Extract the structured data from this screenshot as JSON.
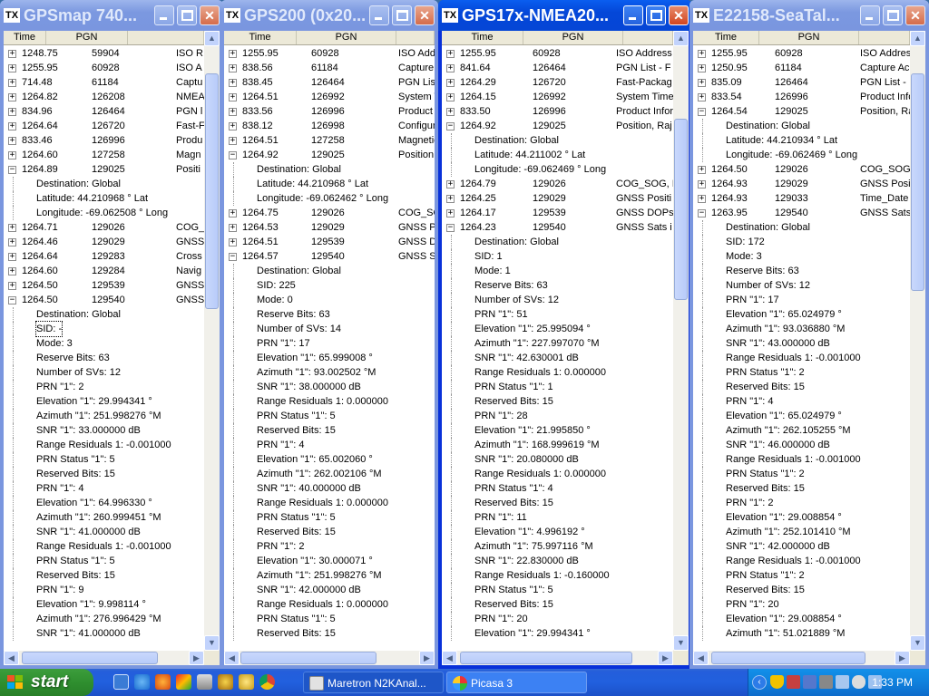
{
  "windows": [
    {
      "title": "GPSmap 740...",
      "active": false,
      "columns": {
        "time": "Time",
        "pgn": "PGN"
      },
      "rows": [
        {
          "t": "n",
          "exp": "+",
          "time": "1248.75",
          "pgn": "59904",
          "desc": "ISO R"
        },
        {
          "t": "n",
          "exp": "+",
          "time": "1255.95",
          "pgn": "60928",
          "desc": "ISO A"
        },
        {
          "t": "n",
          "exp": "+",
          "time": "714.48",
          "pgn": "61184",
          "desc": "Captu"
        },
        {
          "t": "n",
          "exp": "+",
          "time": "1264.82",
          "pgn": "126208",
          "desc": "NMEA"
        },
        {
          "t": "n",
          "exp": "+",
          "time": "834.96",
          "pgn": "126464",
          "desc": "PGN l"
        },
        {
          "t": "n",
          "exp": "+",
          "time": "1264.64",
          "pgn": "126720",
          "desc": "Fast-F"
        },
        {
          "t": "n",
          "exp": "+",
          "time": "833.46",
          "pgn": "126996",
          "desc": "Produ"
        },
        {
          "t": "n",
          "exp": "+",
          "time": "1264.60",
          "pgn": "127258",
          "desc": "Magn"
        },
        {
          "t": "n",
          "exp": "−",
          "time": "1264.89",
          "pgn": "129025",
          "desc": "Positi"
        },
        {
          "t": "f",
          "text": "Destination: Global"
        },
        {
          "t": "f",
          "text": "Latitude: 44.210968 ° Lat"
        },
        {
          "t": "f",
          "text": "Longitude: -69.062508 ° Long"
        },
        {
          "t": "n",
          "exp": "+",
          "time": "1264.71",
          "pgn": "129026",
          "desc": "COG_"
        },
        {
          "t": "n",
          "exp": "+",
          "time": "1264.46",
          "pgn": "129029",
          "desc": "GNSS"
        },
        {
          "t": "n",
          "exp": "+",
          "time": "1264.64",
          "pgn": "129283",
          "desc": "Cross"
        },
        {
          "t": "n",
          "exp": "+",
          "time": "1264.60",
          "pgn": "129284",
          "desc": "Navig"
        },
        {
          "t": "n",
          "exp": "+",
          "time": "1264.50",
          "pgn": "129539",
          "desc": "GNSS"
        },
        {
          "t": "n",
          "exp": "−",
          "time": "1264.50",
          "pgn": "129540",
          "desc": "GNSS"
        },
        {
          "t": "f",
          "text": "Destination: Global"
        },
        {
          "t": "f",
          "text": "SID: -",
          "sel": true
        },
        {
          "t": "f",
          "text": "Mode: 3"
        },
        {
          "t": "f",
          "text": "Reserve Bits: 63"
        },
        {
          "t": "f",
          "text": "Number of SVs: 12"
        },
        {
          "t": "f",
          "text": "PRN \"1\": 2"
        },
        {
          "t": "f",
          "text": "Elevation \"1\": 29.994341 °"
        },
        {
          "t": "f",
          "text": "Azimuth \"1\": 251.998276 °M"
        },
        {
          "t": "f",
          "text": "SNR \"1\": 33.000000 dB"
        },
        {
          "t": "f",
          "text": "Range Residuals 1: -0.001000"
        },
        {
          "t": "f",
          "text": "PRN Status \"1\": 5"
        },
        {
          "t": "f",
          "text": "Reserved Bits: 15"
        },
        {
          "t": "f",
          "text": "PRN \"1\": 4"
        },
        {
          "t": "f",
          "text": "Elevation \"1\": 64.996330 °"
        },
        {
          "t": "f",
          "text": "Azimuth \"1\": 260.999451 °M"
        },
        {
          "t": "f",
          "text": "SNR \"1\": 41.000000 dB"
        },
        {
          "t": "f",
          "text": "Range Residuals 1: -0.001000"
        },
        {
          "t": "f",
          "text": "PRN Status \"1\": 5"
        },
        {
          "t": "f",
          "text": "Reserved Bits: 15"
        },
        {
          "t": "f",
          "text": "PRN \"1\": 9"
        },
        {
          "t": "f",
          "text": "Elevation \"1\": 9.998114 °"
        },
        {
          "t": "f",
          "text": "Azimuth \"1\": 276.996429 °M"
        },
        {
          "t": "f",
          "text": "SNR \"1\": 41.000000 dB"
        }
      ]
    },
    {
      "title": "GPS200 (0x20...",
      "active": false,
      "columns": {
        "time": "Time",
        "pgn": "PGN"
      },
      "rows": [
        {
          "t": "n",
          "exp": "+",
          "time": "1255.95",
          "pgn": "60928",
          "desc": "ISO Addr"
        },
        {
          "t": "n",
          "exp": "+",
          "time": "838.56",
          "pgn": "61184",
          "desc": "Capture A"
        },
        {
          "t": "n",
          "exp": "+",
          "time": "838.45",
          "pgn": "126464",
          "desc": "PGN List"
        },
        {
          "t": "n",
          "exp": "+",
          "time": "1264.51",
          "pgn": "126992",
          "desc": "System T"
        },
        {
          "t": "n",
          "exp": "+",
          "time": "833.56",
          "pgn": "126996",
          "desc": "Product I"
        },
        {
          "t": "n",
          "exp": "+",
          "time": "838.12",
          "pgn": "126998",
          "desc": "Configura"
        },
        {
          "t": "n",
          "exp": "+",
          "time": "1264.51",
          "pgn": "127258",
          "desc": "Magnetic"
        },
        {
          "t": "n",
          "exp": "−",
          "time": "1264.92",
          "pgn": "129025",
          "desc": "Position,"
        },
        {
          "t": "f",
          "text": "Destination: Global"
        },
        {
          "t": "f",
          "text": "Latitude: 44.210968 ° Lat"
        },
        {
          "t": "f",
          "text": "Longitude: -69.062462 ° Long"
        },
        {
          "t": "n",
          "exp": "+",
          "time": "1264.75",
          "pgn": "129026",
          "desc": "COG_SO"
        },
        {
          "t": "n",
          "exp": "+",
          "time": "1264.53",
          "pgn": "129029",
          "desc": "GNSS Po"
        },
        {
          "t": "n",
          "exp": "+",
          "time": "1264.51",
          "pgn": "129539",
          "desc": "GNSS DO"
        },
        {
          "t": "n",
          "exp": "−",
          "time": "1264.57",
          "pgn": "129540",
          "desc": "GNSS Sa"
        },
        {
          "t": "f",
          "text": "Destination: Global"
        },
        {
          "t": "f",
          "text": "SID: 225"
        },
        {
          "t": "f",
          "text": "Mode: 0"
        },
        {
          "t": "f",
          "text": "Reserve Bits: 63"
        },
        {
          "t": "f",
          "text": "Number of SVs: 14"
        },
        {
          "t": "f",
          "text": "PRN \"1\": 17"
        },
        {
          "t": "f",
          "text": "Elevation \"1\": 65.999008 °"
        },
        {
          "t": "f",
          "text": "Azimuth \"1\": 93.002502 °M"
        },
        {
          "t": "f",
          "text": "SNR \"1\": 38.000000 dB"
        },
        {
          "t": "f",
          "text": "Range Residuals 1: 0.000000"
        },
        {
          "t": "f",
          "text": "PRN Status \"1\": 5"
        },
        {
          "t": "f",
          "text": "Reserved Bits: 15"
        },
        {
          "t": "f",
          "text": "PRN \"1\": 4"
        },
        {
          "t": "f",
          "text": "Elevation \"1\": 65.002060 °"
        },
        {
          "t": "f",
          "text": "Azimuth \"1\": 262.002106 °M"
        },
        {
          "t": "f",
          "text": "SNR \"1\": 40.000000 dB"
        },
        {
          "t": "f",
          "text": "Range Residuals 1: 0.000000"
        },
        {
          "t": "f",
          "text": "PRN Status \"1\": 5"
        },
        {
          "t": "f",
          "text": "Reserved Bits: 15"
        },
        {
          "t": "f",
          "text": "PRN \"1\": 2"
        },
        {
          "t": "f",
          "text": "Elevation \"1\": 30.000071 °"
        },
        {
          "t": "f",
          "text": "Azimuth \"1\": 251.998276 °M"
        },
        {
          "t": "f",
          "text": "SNR \"1\": 42.000000 dB"
        },
        {
          "t": "f",
          "text": "Range Residuals 1: 0.000000"
        },
        {
          "t": "f",
          "text": "PRN Status \"1\": 5"
        },
        {
          "t": "f",
          "text": "Reserved Bits: 15"
        }
      ]
    },
    {
      "title": "GPS17x-NMEA20...",
      "active": true,
      "columns": {
        "time": "Time",
        "pgn": "PGN"
      },
      "rows": [
        {
          "t": "n",
          "exp": "+",
          "time": "1255.95",
          "pgn": "60928",
          "desc": "ISO Address"
        },
        {
          "t": "n",
          "exp": "+",
          "time": "841.64",
          "pgn": "126464",
          "desc": "PGN List - F"
        },
        {
          "t": "n",
          "exp": "+",
          "time": "1264.29",
          "pgn": "126720",
          "desc": "Fast-Packag"
        },
        {
          "t": "n",
          "exp": "+",
          "time": "1264.15",
          "pgn": "126992",
          "desc": "System Time"
        },
        {
          "t": "n",
          "exp": "+",
          "time": "833.50",
          "pgn": "126996",
          "desc": "Product Infor"
        },
        {
          "t": "n",
          "exp": "−",
          "time": "1264.92",
          "pgn": "129025",
          "desc": "Position, Raj"
        },
        {
          "t": "f",
          "text": "Destination: Global"
        },
        {
          "t": "f",
          "text": "Latitude: 44.211002 ° Lat"
        },
        {
          "t": "f",
          "text": "Longitude: -69.062469 ° Long"
        },
        {
          "t": "n",
          "exp": "+",
          "time": "1264.79",
          "pgn": "129026",
          "desc": "COG_SOG, I"
        },
        {
          "t": "n",
          "exp": "+",
          "time": "1264.25",
          "pgn": "129029",
          "desc": "GNSS Positi"
        },
        {
          "t": "n",
          "exp": "+",
          "time": "1264.17",
          "pgn": "129539",
          "desc": "GNSS DOPs"
        },
        {
          "t": "n",
          "exp": "−",
          "time": "1264.23",
          "pgn": "129540",
          "desc": "GNSS Sats i"
        },
        {
          "t": "f",
          "text": "Destination: Global"
        },
        {
          "t": "f",
          "text": "SID: 1"
        },
        {
          "t": "f",
          "text": "Mode: 1"
        },
        {
          "t": "f",
          "text": "Reserve Bits: 63"
        },
        {
          "t": "f",
          "text": "Number of SVs: 12"
        },
        {
          "t": "f",
          "text": "PRN \"1\": 51"
        },
        {
          "t": "f",
          "text": "Elevation \"1\": 25.995094 °"
        },
        {
          "t": "f",
          "text": "Azimuth \"1\": 227.997070 °M"
        },
        {
          "t": "f",
          "text": "SNR \"1\": 42.630001 dB"
        },
        {
          "t": "f",
          "text": "Range Residuals 1: 0.000000"
        },
        {
          "t": "f",
          "text": "PRN Status \"1\": 1"
        },
        {
          "t": "f",
          "text": "Reserved Bits: 15"
        },
        {
          "t": "f",
          "text": "PRN \"1\": 28"
        },
        {
          "t": "f",
          "text": "Elevation \"1\": 21.995850 °"
        },
        {
          "t": "f",
          "text": "Azimuth \"1\": 168.999619 °M"
        },
        {
          "t": "f",
          "text": "SNR \"1\": 20.080000 dB"
        },
        {
          "t": "f",
          "text": "Range Residuals 1: 0.000000"
        },
        {
          "t": "f",
          "text": "PRN Status \"1\": 4"
        },
        {
          "t": "f",
          "text": "Reserved Bits: 15"
        },
        {
          "t": "f",
          "text": "PRN \"1\": 11"
        },
        {
          "t": "f",
          "text": "Elevation \"1\": 4.996192 °"
        },
        {
          "t": "f",
          "text": "Azimuth \"1\": 75.997116 °M"
        },
        {
          "t": "f",
          "text": "SNR \"1\": 22.830000 dB"
        },
        {
          "t": "f",
          "text": "Range Residuals 1: -0.160000"
        },
        {
          "t": "f",
          "text": "PRN Status \"1\": 5"
        },
        {
          "t": "f",
          "text": "Reserved Bits: 15"
        },
        {
          "t": "f",
          "text": "PRN \"1\": 20"
        },
        {
          "t": "f",
          "text": "Elevation \"1\": 29.994341 °"
        }
      ]
    },
    {
      "title": "E22158-SeaTal...",
      "active": false,
      "columns": {
        "time": "Time",
        "pgn": "PGN"
      },
      "rows": [
        {
          "t": "n",
          "exp": "+",
          "time": "1255.95",
          "pgn": "60928",
          "desc": "ISO Addres"
        },
        {
          "t": "n",
          "exp": "+",
          "time": "1250.95",
          "pgn": "61184",
          "desc": "Capture Acl"
        },
        {
          "t": "n",
          "exp": "+",
          "time": "835.09",
          "pgn": "126464",
          "desc": "PGN List -"
        },
        {
          "t": "n",
          "exp": "+",
          "time": "833.54",
          "pgn": "126996",
          "desc": "Product Info"
        },
        {
          "t": "n",
          "exp": "−",
          "time": "1264.54",
          "pgn": "129025",
          "desc": "Position, Ra"
        },
        {
          "t": "f",
          "text": "Destination: Global"
        },
        {
          "t": "f",
          "text": "Latitude: 44.210934 ° Lat"
        },
        {
          "t": "f",
          "text": "Longitude: -69.062469 ° Long"
        },
        {
          "t": "n",
          "exp": "+",
          "time": "1264.50",
          "pgn": "129026",
          "desc": "COG_SOG,"
        },
        {
          "t": "n",
          "exp": "+",
          "time": "1264.93",
          "pgn": "129029",
          "desc": "GNSS Posi"
        },
        {
          "t": "n",
          "exp": "+",
          "time": "1264.93",
          "pgn": "129033",
          "desc": "Time_Date"
        },
        {
          "t": "n",
          "exp": "−",
          "time": "1263.95",
          "pgn": "129540",
          "desc": "GNSS Sats"
        },
        {
          "t": "f",
          "text": "Destination: Global"
        },
        {
          "t": "f",
          "text": "SID: 172"
        },
        {
          "t": "f",
          "text": "Mode: 3"
        },
        {
          "t": "f",
          "text": "Reserve Bits: 63"
        },
        {
          "t": "f",
          "text": "Number of SVs: 12"
        },
        {
          "t": "f",
          "text": "PRN \"1\": 17"
        },
        {
          "t": "f",
          "text": "Elevation \"1\": 65.024979 °"
        },
        {
          "t": "f",
          "text": "Azimuth \"1\": 93.036880 °M"
        },
        {
          "t": "f",
          "text": "SNR \"1\": 43.000000 dB"
        },
        {
          "t": "f",
          "text": "Range Residuals 1: -0.001000"
        },
        {
          "t": "f",
          "text": "PRN Status \"1\": 2"
        },
        {
          "t": "f",
          "text": "Reserved Bits: 15"
        },
        {
          "t": "f",
          "text": "PRN \"1\": 4"
        },
        {
          "t": "f",
          "text": "Elevation \"1\": 65.024979 °"
        },
        {
          "t": "f",
          "text": "Azimuth \"1\": 262.105255 °M"
        },
        {
          "t": "f",
          "text": "SNR \"1\": 46.000000 dB"
        },
        {
          "t": "f",
          "text": "Range Residuals 1: -0.001000"
        },
        {
          "t": "f",
          "text": "PRN Status \"1\": 2"
        },
        {
          "t": "f",
          "text": "Reserved Bits: 15"
        },
        {
          "t": "f",
          "text": "PRN \"1\": 2"
        },
        {
          "t": "f",
          "text": "Elevation \"1\": 29.008854 °"
        },
        {
          "t": "f",
          "text": "Azimuth \"1\": 252.101410 °M"
        },
        {
          "t": "f",
          "text": "SNR \"1\": 42.000000 dB"
        },
        {
          "t": "f",
          "text": "Range Residuals 1: -0.001000"
        },
        {
          "t": "f",
          "text": "PRN Status \"1\": 2"
        },
        {
          "t": "f",
          "text": "Reserved Bits: 15"
        },
        {
          "t": "f",
          "text": "PRN \"1\": 20"
        },
        {
          "t": "f",
          "text": "Elevation \"1\": 29.008854 °"
        },
        {
          "t": "f",
          "text": "Azimuth \"1\": 51.021889 °M"
        }
      ]
    }
  ],
  "window_icon_label": "TX",
  "taskbar": {
    "start_label": "start",
    "tasks": [
      {
        "label": "Maretron N2KAnal...",
        "icon": "analyzer-icon",
        "active": false
      },
      {
        "label": "Picasa 3",
        "icon": "picasa-icon",
        "active": false
      }
    ],
    "clock": "1:33 PM"
  },
  "colors": {
    "active_title": "#0a5ef0",
    "inactive_title": "#7a96df",
    "taskbar": "#245edb",
    "start": "#2f8f2f",
    "tray": "#1081dd"
  }
}
